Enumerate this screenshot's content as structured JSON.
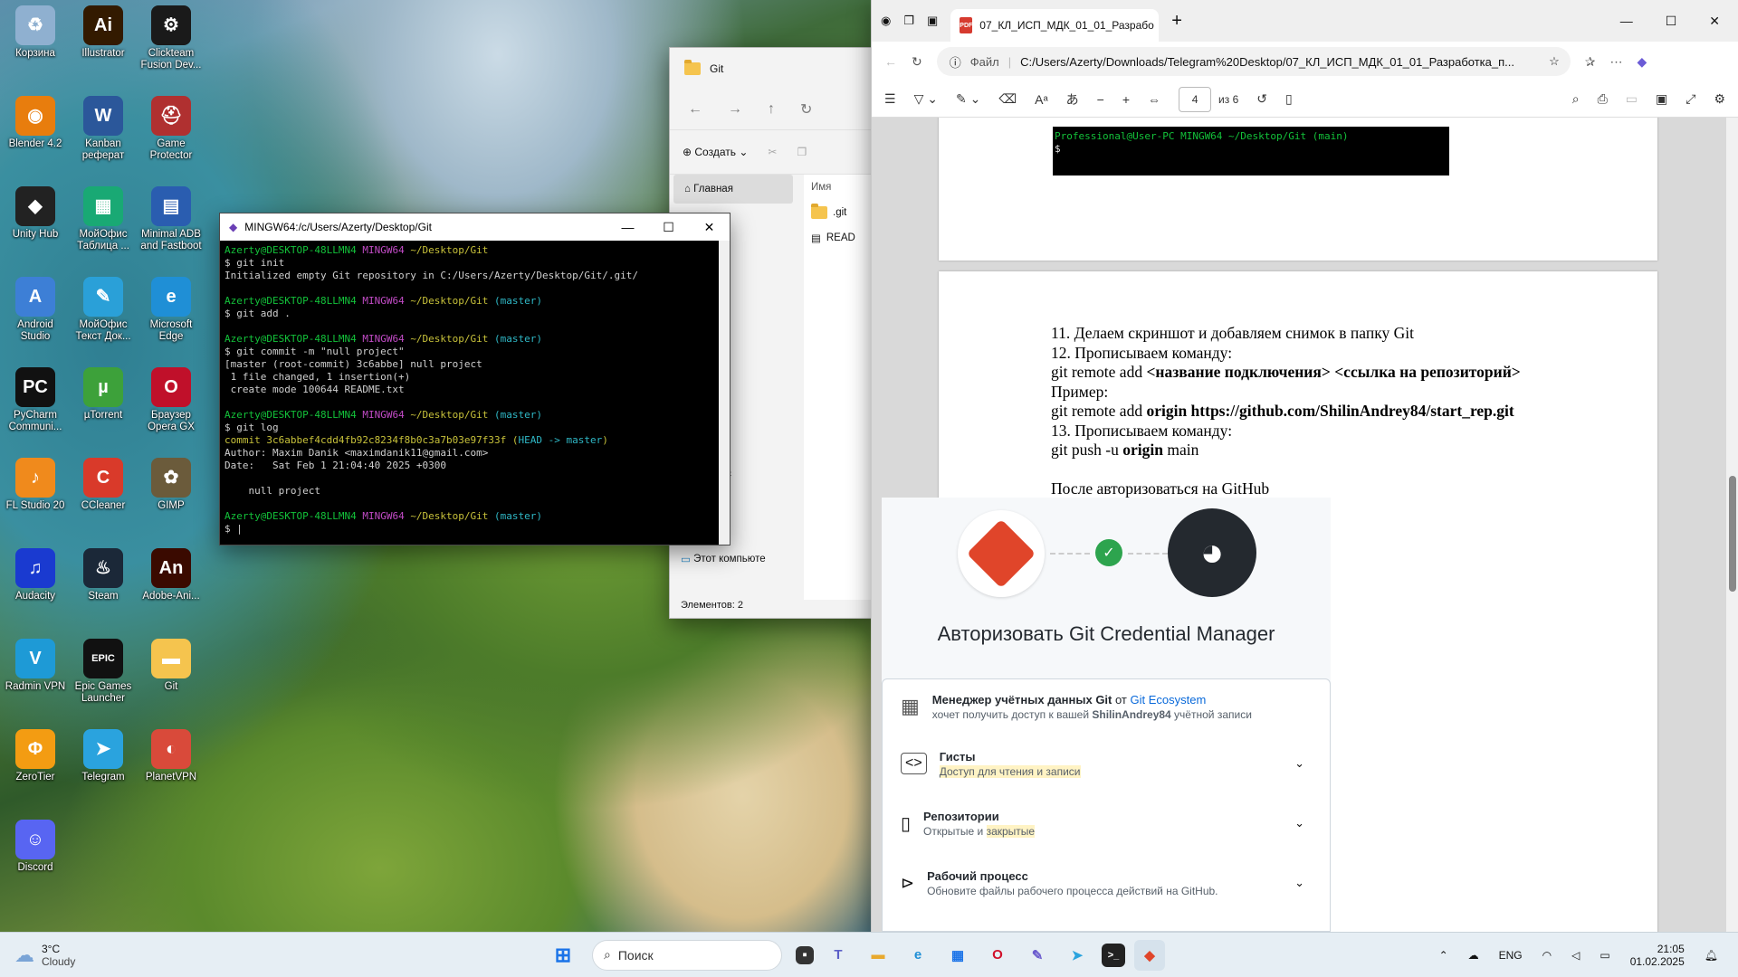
{
  "desktop": {
    "icons": [
      {
        "label": "Корзина",
        "icon": "recycle-bin-icon",
        "color": "#8fb0d0",
        "glyph": "♻"
      },
      {
        "label": "Illustrator",
        "icon": "illustrator-icon",
        "color": "#331a00",
        "glyph": "Ai"
      },
      {
        "label": "Clickteam Fusion Dev...",
        "icon": "clickteam-icon",
        "color": "#1a1a1a",
        "glyph": "⚙"
      },
      {
        "label": "Blender 4.2",
        "icon": "blender-icon",
        "color": "#e87d0d",
        "glyph": "◉"
      },
      {
        "label": "Kanban реферат",
        "icon": "word-doc-icon",
        "color": "#2b579a",
        "glyph": "W"
      },
      {
        "label": "Game Protector",
        "icon": "game-protector-icon",
        "color": "#b03030",
        "glyph": "⛑"
      },
      {
        "label": "Unity Hub",
        "icon": "unity-icon",
        "color": "#222",
        "glyph": "◆"
      },
      {
        "label": "МойОфис Таблица ...",
        "icon": "myoffice-sheet-icon",
        "color": "#19a974",
        "glyph": "▦"
      },
      {
        "label": "Minimal ADB and Fastboot",
        "icon": "adb-icon",
        "color": "#2a5db0",
        "glyph": "▤"
      },
      {
        "label": "Android Studio",
        "icon": "android-studio-icon",
        "color": "#3d7fd6",
        "glyph": "A"
      },
      {
        "label": "МойОфис Текст Док...",
        "icon": "myoffice-text-icon",
        "color": "#2aa0d8",
        "glyph": "✎"
      },
      {
        "label": "Microsoft Edge",
        "icon": "edge-icon",
        "color": "#1f8fd6",
        "glyph": "e"
      },
      {
        "label": "PyCharm Communi...",
        "icon": "pycharm-icon",
        "color": "#111",
        "glyph": "PC"
      },
      {
        "label": "µTorrent",
        "icon": "utorrent-icon",
        "color": "#3da13a",
        "glyph": "µ"
      },
      {
        "label": "Браузер Opera GX",
        "icon": "opera-gx-icon",
        "color": "#c0102a",
        "glyph": "O"
      },
      {
        "label": "FL Studio 20",
        "icon": "fl-studio-icon",
        "color": "#f08a1c",
        "glyph": "♪"
      },
      {
        "label": "CCleaner",
        "icon": "ccleaner-icon",
        "color": "#d93a2a",
        "glyph": "C"
      },
      {
        "label": "GIMP",
        "icon": "gimp-icon",
        "color": "#6b5b3b",
        "glyph": "✿"
      },
      {
        "label": "Audacity",
        "icon": "audacity-icon",
        "color": "#1a3ad0",
        "glyph": "♫"
      },
      {
        "label": "Steam",
        "icon": "steam-icon",
        "color": "#1b2838",
        "glyph": "♨"
      },
      {
        "label": "Adobe-Ani...",
        "icon": "adobe-animate-icon",
        "color": "#3a0a00",
        "glyph": "An"
      },
      {
        "label": "Radmin VPN",
        "icon": "radmin-vpn-icon",
        "color": "#1e9ad6",
        "glyph": "V"
      },
      {
        "label": "Epic Games Launcher",
        "icon": "epic-games-icon",
        "color": "#111",
        "glyph": "EPIC"
      },
      {
        "label": "Git",
        "icon": "folder-icon",
        "color": "#f5c44e",
        "glyph": "▬"
      },
      {
        "label": "ZeroTier",
        "icon": "zerotier-icon",
        "color": "#f39c12",
        "glyph": "Φ"
      },
      {
        "label": "Telegram",
        "icon": "telegram-icon",
        "color": "#2aa3de",
        "glyph": "➤"
      },
      {
        "label": "PlanetVPN",
        "icon": "planetvpn-icon",
        "color": "#d94a3a",
        "glyph": "◐"
      },
      {
        "label": "Discord",
        "icon": "discord-icon",
        "color": "#5865f2",
        "glyph": "☺"
      }
    ]
  },
  "explorer": {
    "title": "Git",
    "create": "Создать",
    "sidebar": [
      "Главная",
      "орея",
      "к — Личн",
      "узки",
      "ементы",
      "чий сто",
      "ика",
      "ражени",
      "о",
      "y New ",
      "льный дис",
      "",
      "",
      "",
      "Этот компьюте"
    ],
    "column": "Имя",
    "files": [
      ".git",
      "READ"
    ],
    "status": "Элементов: 2"
  },
  "terminal": {
    "title": "MINGW64:/c/Users/Azerty/Desktop/Git",
    "user": "Azerty@DESKTOP-48LLMN4",
    "mingw": "MINGW64",
    "path": "~/Desktop/Git",
    "branch": "(master)",
    "cmd1": "$ git init",
    "out1": "Initialized empty Git repository in C:/Users/Azerty/Desktop/Git/.git/",
    "cmd2": "$ git add .",
    "cmd3": "$ git commit -m \"null project\"",
    "out3a": "[master (root-commit) 3c6abbe] null project",
    "out3b": " 1 file changed, 1 insertion(+)",
    "out3c": " create mode 100644 README.txt",
    "cmd4": "$ git log",
    "commit": "commit 3c6abbef4cdd4fb92c8234f8b0c3a7b03e97f33f",
    "head": "HEAD -> master",
    "author": "Author: Maxim Danik <maximdanik11@gmail.com>",
    "date": "Date:   Sat Feb 1 21:04:40 2025 +0300",
    "msg": "    null project",
    "prompt": "$ "
  },
  "browser": {
    "tab_title": "07_КЛ_ИСП_МДК_01_01_Разрабо",
    "url_label": "Файл",
    "url": "C:/Users/Azerty/Downloads/Telegram%20Desktop/07_КЛ_ИСП_МДК_01_01_Разработка_п...",
    "page_num": "4",
    "page_of": "из 6",
    "prev_term": {
      "line1": "Professional@User-PC MINGW64 ~/Desktop/Git (main)",
      "line2": "$ "
    },
    "doc": {
      "l11": "11. Делаем скриншот и добавляем снимок в папку Git",
      "l12": "12. Прописываем команду:",
      "l12a_pre": "git remote add ",
      "l12a_bold": "<название подключения> <ссылка на репозиторий>",
      "l_ex": "Пример:",
      "lex_pre": "git remote add ",
      "lex_bold": "origin https://github.com/ShilinAndrey84/start_rep.git",
      "l13": "13. Прописываем команду:",
      "l13a_pre": "git push -u ",
      "l13a_bold": "origin",
      "l13a_post": " main",
      "lauth": "После авторизоваться на GitHub"
    },
    "gcm": {
      "title": "Авторизовать Git Credential Manager",
      "app_pre": "Менеджер учётных данных Git",
      "app_from": " от ",
      "app_link": "Git Ecosystem",
      "app_sub_pre": "хочет получить доступ к вашей ",
      "app_user": "ShilinAndrey84",
      "app_sub_post": " учётной записи",
      "perms": [
        {
          "t": "Гисты",
          "s_hl": "Доступ для чтения и записи",
          "s_pre": "",
          "s_post": "",
          "icon": "code-icon"
        },
        {
          "t": "Репозитории",
          "s_pre": "Открытые и ",
          "s_hl": "закрытые",
          "s_post": "",
          "icon": "repo-icon"
        },
        {
          "t": "Рабочий процесс",
          "s_pre": "Обновите файлы рабочего процесса действий на GitHub.",
          "s_hl": "",
          "s_post": "",
          "icon": "play-icon"
        }
      ]
    }
  },
  "taskbar": {
    "weather_temp": "3°C",
    "weather_text": "Cloudy",
    "search": "Поиск",
    "lang": "ENG",
    "time": "21:05",
    "date": "01.02.2025"
  }
}
